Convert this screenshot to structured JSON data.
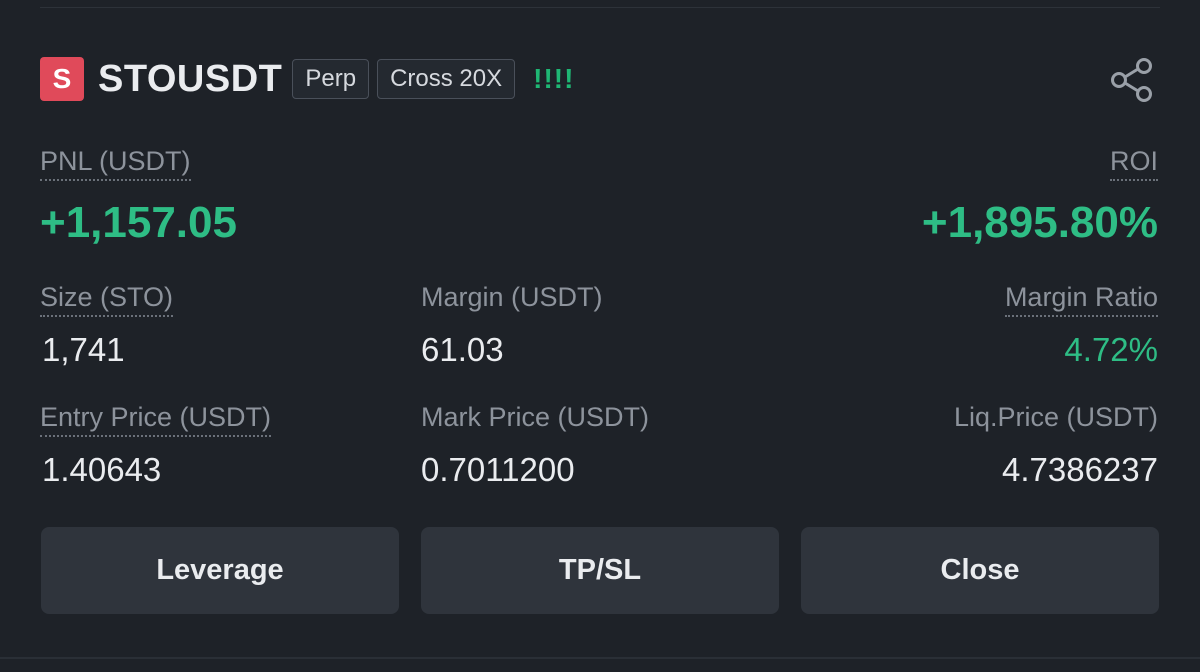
{
  "header": {
    "side_badge": "S",
    "symbol": "STOUSDT",
    "tag_perp": "Perp",
    "tag_margin": "Cross 20X",
    "risk_indicator": "!!!!"
  },
  "pnl": {
    "label": "PNL (USDT)",
    "value": "+1,157.05"
  },
  "roi": {
    "label": "ROI",
    "value": "+1,895.80%"
  },
  "size": {
    "label": "Size (STO)",
    "value": "1,741"
  },
  "margin": {
    "label": "Margin (USDT)",
    "value": "61.03"
  },
  "margin_ratio": {
    "label": "Margin Ratio",
    "value": "4.72%"
  },
  "entry_price": {
    "label": "Entry Price (USDT)",
    "value": "1.40643"
  },
  "mark_price": {
    "label": "Mark Price (USDT)",
    "value": "0.7011200"
  },
  "liq_price": {
    "label": "Liq.Price (USDT)",
    "value": "4.7386237"
  },
  "buttons": {
    "leverage": "Leverage",
    "tpsl": "TP/SL",
    "close": "Close"
  },
  "colors": {
    "positive": "#2ebd85",
    "short_badge": "#e04a5a",
    "background": "#1e2228"
  },
  "icons": {
    "share": "share-icon"
  }
}
